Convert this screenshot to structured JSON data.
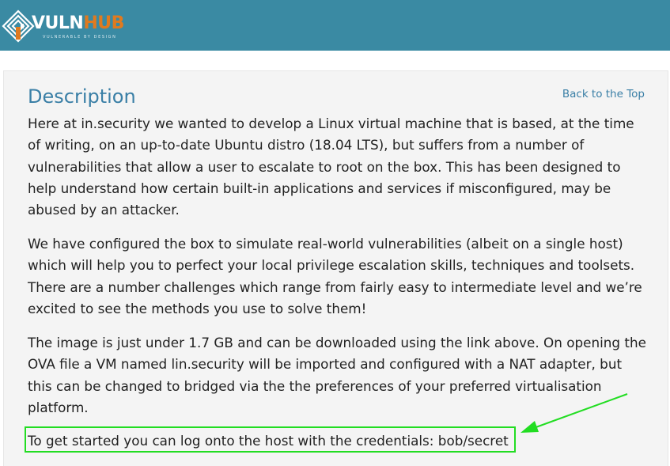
{
  "header": {
    "logo_text_primary": "VULN",
    "logo_text_secondary": "HUB",
    "logo_tagline": "VULNERABLE BY DESIGN",
    "background_color": "#3a8aa3",
    "accent_color": "#e07a1f"
  },
  "description": {
    "title": "Description",
    "back_to_top": "Back to the Top",
    "paragraphs": [
      "Here at in.security we wanted to develop a Linux virtual machine that is based, at the time of writing, on an up-to-date Ubuntu distro (18.04 LTS), but suffers from a number of vulnerabilities that allow a user to escalate to root on the box. This has been designed to help understand how certain built-in applications and services if misconfigured, may be abused by an attacker.",
      "We have configured the box to simulate real-world vulnerabilities (albeit on a single host) which will help you to perfect your local privilege escalation skills, techniques and toolsets. There are a number challenges which range from fairly easy to intermediate level and we’re excited to see the methods you use to solve them!",
      "The image is just under 1.7 GB and can be downloaded using the link above. On opening the OVA file a VM named lin.security will be imported and configured with a NAT adapter, but this can be changed to bridged via the the preferences of your preferred virtualisation platform.",
      "To get started you can log onto the host with the credentials: bob/secret"
    ]
  },
  "annotation": {
    "highlight_color": "#22dd22",
    "arrow_icon": "arrow-left-down-icon"
  }
}
